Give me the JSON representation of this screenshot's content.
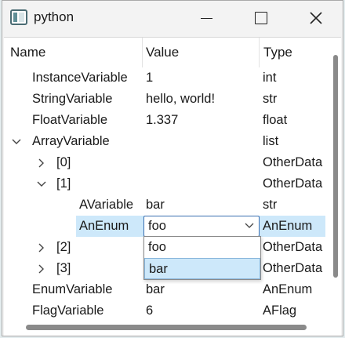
{
  "window": {
    "title": "python"
  },
  "header": {
    "name": "Name",
    "value": "Value",
    "type": "Type"
  },
  "rows": [
    {
      "name": "InstanceVariable",
      "value": "1",
      "type": "int"
    },
    {
      "name": "StringVariable",
      "value": "hello, world!",
      "type": "str"
    },
    {
      "name": "FloatVariable",
      "value": "1.337",
      "type": "float"
    },
    {
      "name": "ArrayVariable",
      "value": "",
      "type": "list"
    },
    {
      "name": "[0]",
      "value": "",
      "type": "OtherData"
    },
    {
      "name": "[1]",
      "value": "",
      "type": "OtherData"
    },
    {
      "name": "AVariable",
      "value": "bar",
      "type": "str"
    },
    {
      "name": "AnEnum",
      "value": "foo",
      "type": "AnEnum"
    },
    {
      "name": "[2]",
      "value": "",
      "type": "OtherData"
    },
    {
      "name": "[3]",
      "value": "",
      "type": "OtherData"
    },
    {
      "name": "EnumVariable",
      "value": "bar",
      "type": "AnEnum"
    },
    {
      "name": "FlagVariable",
      "value": "6",
      "type": "AFlag"
    }
  ],
  "dropdown": {
    "options": [
      "foo",
      "bar"
    ],
    "highlighted": "bar"
  },
  "icons": {
    "minimize": "minimize-icon",
    "maximize": "maximize-icon",
    "close": "close-icon",
    "expand": "chevron-right-icon",
    "collapse": "chevron-down-icon"
  }
}
